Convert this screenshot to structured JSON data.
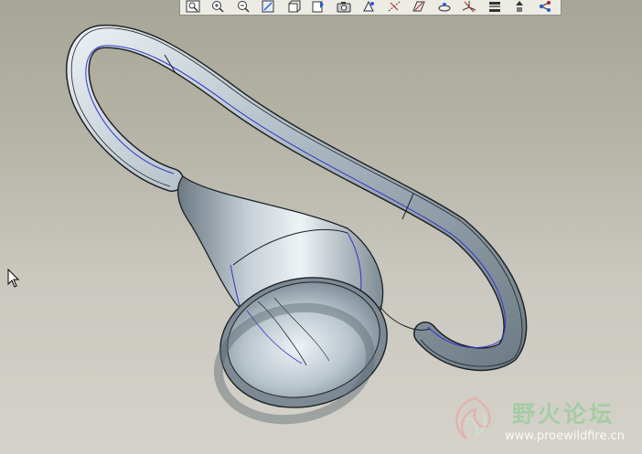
{
  "toolbar": {
    "buttons": [
      {
        "name": "refit-icon"
      },
      {
        "name": "zoom-in-icon"
      },
      {
        "name": "zoom-out-icon"
      },
      {
        "name": "repaint-icon"
      },
      {
        "name": "spin-center-icon"
      },
      {
        "name": "view-manager-icon"
      },
      {
        "name": "saved-views-icon"
      },
      {
        "name": "orient-icon"
      },
      {
        "name": "datum-axes-icon"
      },
      {
        "name": "datum-planes-icon"
      },
      {
        "name": "datum-points-icon"
      },
      {
        "name": "coordinate-systems-icon"
      },
      {
        "name": "annotation-display-icon"
      },
      {
        "name": "spin-toggle-icon"
      },
      {
        "name": "network-icon"
      }
    ]
  },
  "colors": {
    "model_body": "#b9c4cc",
    "model_edge": "#1d2226",
    "tangent_edge": "#3236c8",
    "background_top": "#a7a595",
    "background_bottom": "#d4d2ca"
  },
  "watermark": {
    "title": "野火论坛",
    "url": "www.proewildfire.cn"
  }
}
